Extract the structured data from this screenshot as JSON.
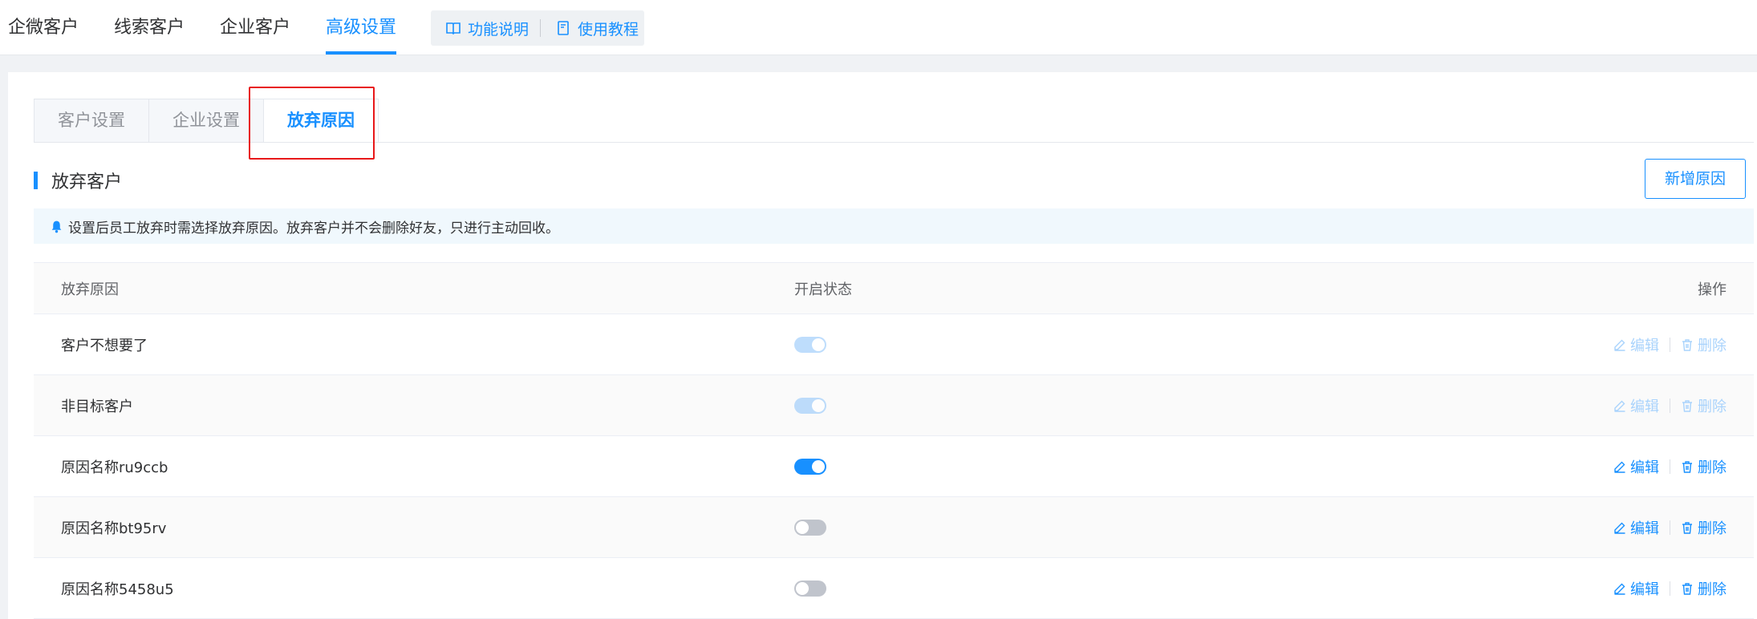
{
  "topnav": {
    "items": [
      "企微客户",
      "线索客户",
      "企业客户",
      "高级设置"
    ],
    "active_index": 3,
    "help_links": [
      "功能说明",
      "使用教程"
    ]
  },
  "subtabs": {
    "items": [
      "客户设置",
      "企业设置",
      "放弃原因"
    ],
    "active_index": 2
  },
  "section": {
    "title": "放弃客户",
    "add_button": "新增原因",
    "notice": "设置后员工放弃时需选择放弃原因。放弃客户并不会删除好友，只进行主动回收。"
  },
  "table": {
    "headers": [
      "放弃原因",
      "开启状态",
      "操作"
    ],
    "rows": [
      {
        "reason": "客户不想要了",
        "enabled": true,
        "disabled": true
      },
      {
        "reason": "非目标客户",
        "enabled": true,
        "disabled": true
      },
      {
        "reason": "原因名称ru9ccb",
        "enabled": true,
        "disabled": false
      },
      {
        "reason": "原因名称bt95rv",
        "enabled": false,
        "disabled": false
      },
      {
        "reason": "原因名称5458u5",
        "enabled": false,
        "disabled": false
      }
    ],
    "edit_label": "编辑",
    "delete_label": "删除"
  },
  "colors": {
    "accent": "#1890ff",
    "highlight": "#e8181a"
  }
}
